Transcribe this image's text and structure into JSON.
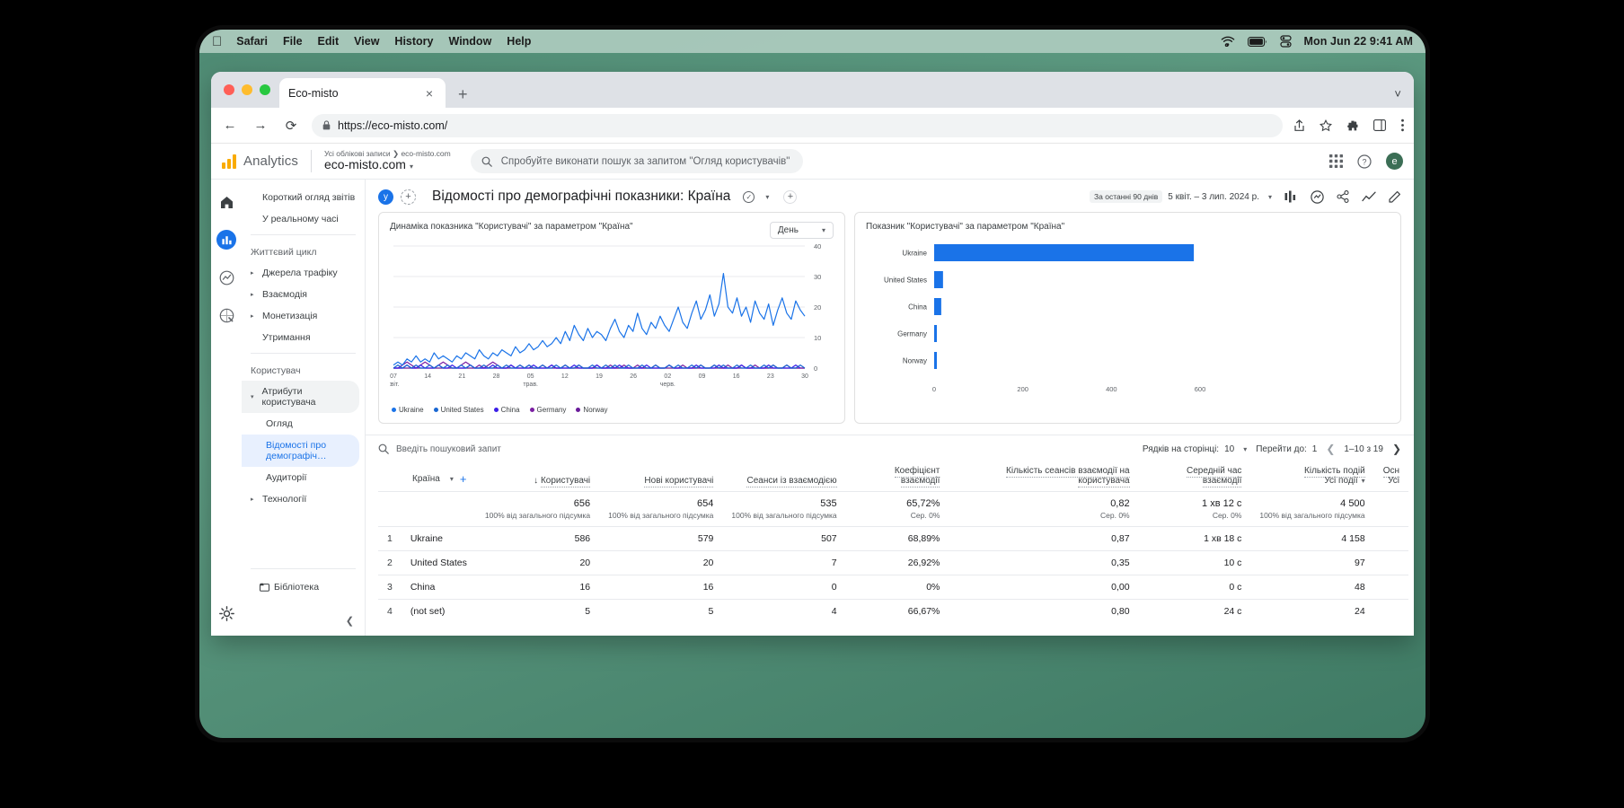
{
  "menubar": {
    "apple": "apple-logo",
    "items": [
      "Safari",
      "File",
      "Edit",
      "View",
      "History",
      "Window",
      "Help"
    ],
    "clock": "Mon Jun 22  9:41 AM",
    "icons": [
      "wifi-icon",
      "battery-icon",
      "control-center-icon"
    ]
  },
  "browser": {
    "tab_title": "Eco-misto",
    "tab_close": "×",
    "new_tab": "+",
    "tabs_chevron": "˅",
    "back": "←",
    "forward": "→",
    "reload": "⟳",
    "lock": "🔒",
    "url": "https://eco-misto.com/",
    "toolbar_icons": [
      "share-icon",
      "bookmark-star-icon",
      "extensions-icon",
      "sidebar-icon",
      "menu-kebab-icon"
    ]
  },
  "ga_header": {
    "product": "Analytics",
    "breadcrumb": "Усі облікові записи  ❯  eco-misto.com",
    "property": "eco-misto.com",
    "property_caret": "▾",
    "search_placeholder": "Спробуйте виконати пошук за запитом \"Огляд користувачів\"",
    "search_icon": "search-icon",
    "apps_icon": "apps-grid-icon",
    "help_icon": "help-circle-icon",
    "avatar_letter": "e"
  },
  "rail": {
    "items": [
      "home-icon",
      "reports-icon",
      "explore-icon",
      "advertising-icon"
    ],
    "active_index": 1,
    "settings": "gear-icon"
  },
  "sidebar": {
    "top_items": [
      {
        "label": "Короткий огляд звітів"
      },
      {
        "label": "У реальному часі"
      }
    ],
    "group_lifecycle": "Життєвий цикл",
    "lifecycle_items": [
      {
        "label": "Джерела трафіку",
        "caret": "▸"
      },
      {
        "label": "Взаємодія",
        "caret": "▸"
      },
      {
        "label": "Монетизація",
        "caret": "▸"
      },
      {
        "label": "Утримання",
        "caret": ""
      }
    ],
    "group_user": "Користувач",
    "user_items": [
      {
        "label": "Атрибути користувача",
        "caret": "▾"
      }
    ],
    "user_subitems": [
      {
        "label": "Огляд",
        "active": false
      },
      {
        "label": "Відомості про демографіч…",
        "active": true
      },
      {
        "label": "Аудиторії",
        "active": false
      }
    ],
    "tech_item": {
      "label": "Технології",
      "caret": "▸"
    },
    "library": {
      "label": "Бібліотека",
      "icon": "library-icon"
    },
    "collapse_icon": "chevron-left-icon"
  },
  "page": {
    "chip_y": "у",
    "chip_plus": "+",
    "title": "Відомості про демографічні показники: Країна",
    "check_icon": "check-circle-icon",
    "caret": "▾",
    "add_comparison": "+",
    "date_badge": "За останні 90 днів",
    "date_range": "5 квіт. – 3 лип. 2024 р.",
    "date_caret": "▾",
    "actions": [
      "insights-icon",
      "share-insights-icon",
      "share-icon",
      "trend-icon",
      "edit-pencil-icon"
    ]
  },
  "cards": {
    "left": {
      "title": "Динаміка показника \"Користувачі\" за параметром \"Країна\"",
      "granularity": "День",
      "granularity_caret": "▾"
    },
    "right": {
      "title": "Показник \"Користувачі\" за параметром \"Країна\""
    }
  },
  "legend": [
    {
      "label": "Ukraine",
      "color": "#1a73e8"
    },
    {
      "label": "United States",
      "color": "#1967d2"
    },
    {
      "label": "China",
      "color": "#3b1ee8"
    },
    {
      "label": "Germany",
      "color": "#7b1fa2"
    },
    {
      "label": "Norway",
      "color": "#6a1b9a"
    }
  ],
  "chart_data": [
    {
      "type": "line",
      "title": "Динаміка показника \"Користувачі\" за параметром \"Країна\"",
      "xlabel": "",
      "ylabel": "",
      "ylim": [
        0,
        40
      ],
      "yticks": [
        0,
        10,
        20,
        30,
        40
      ],
      "xticks": [
        "07\nквіт.",
        "14",
        "21",
        "28",
        "05\nтрав.",
        "12",
        "19",
        "26",
        "02\nчерв.",
        "09",
        "16",
        "23",
        "30"
      ],
      "grid": true,
      "legend_position": "bottom",
      "series": [
        {
          "name": "Ukraine",
          "color": "#1a73e8",
          "values": [
            1,
            2,
            1,
            3,
            2,
            4,
            2,
            3,
            2,
            5,
            3,
            4,
            3,
            2,
            4,
            3,
            5,
            4,
            3,
            6,
            4,
            3,
            5,
            4,
            6,
            5,
            4,
            7,
            5,
            6,
            8,
            6,
            7,
            9,
            7,
            8,
            10,
            8,
            12,
            9,
            14,
            11,
            9,
            13,
            10,
            12,
            11,
            9,
            13,
            16,
            12,
            10,
            14,
            12,
            18,
            13,
            11,
            15,
            13,
            17,
            14,
            12,
            16,
            20,
            15,
            13,
            18,
            22,
            16,
            19,
            24,
            17,
            21,
            31,
            20,
            18,
            23,
            17,
            20,
            15,
            22,
            18,
            16,
            21,
            14,
            19,
            23,
            18,
            16,
            22,
            19,
            17
          ]
        },
        {
          "name": "United States",
          "color": "#1967d2",
          "values": [
            0,
            1,
            0,
            1,
            0,
            1,
            0,
            0,
            1,
            0,
            1,
            0,
            1,
            0,
            0,
            1,
            0,
            1,
            0,
            0,
            1,
            0,
            0,
            1,
            0,
            1,
            0,
            0,
            1,
            0,
            1,
            0,
            0,
            1,
            0,
            0,
            1,
            0,
            1,
            0,
            0,
            1,
            0,
            0,
            1,
            0,
            0,
            1,
            0,
            1,
            0,
            0,
            1,
            0,
            0,
            1,
            0,
            0,
            1,
            0,
            0,
            1,
            0,
            1,
            0,
            0,
            1,
            0,
            1,
            0,
            0,
            1,
            0,
            1,
            0,
            0,
            1,
            0,
            0,
            1,
            0,
            0,
            1,
            0,
            1,
            0,
            0,
            1,
            0,
            0,
            1,
            0
          ]
        },
        {
          "name": "China",
          "color": "#3b1ee8",
          "values": [
            0,
            0,
            0,
            1,
            0,
            0,
            1,
            0,
            0,
            0,
            1,
            0,
            0,
            1,
            0,
            0,
            0,
            1,
            0,
            0,
            0,
            0,
            1,
            0,
            0,
            0,
            1,
            0,
            0,
            0,
            0,
            1,
            0,
            0,
            0,
            1,
            0,
            0,
            0,
            0,
            1,
            0,
            0,
            0,
            0,
            1,
            0,
            0,
            0,
            0,
            1,
            0,
            0,
            0,
            0,
            0,
            1,
            0,
            0,
            0,
            0,
            1,
            0,
            0,
            0,
            0,
            0,
            1,
            0,
            0,
            0,
            0,
            1,
            0,
            0,
            0,
            0,
            1,
            0,
            0,
            0,
            0,
            0,
            1,
            0,
            0,
            0,
            0,
            0,
            1,
            0
          ]
        },
        {
          "name": "Germany",
          "color": "#7b1fa2",
          "values": [
            0,
            0,
            1,
            2,
            1,
            0,
            1,
            2,
            1,
            0,
            1,
            2,
            1,
            0,
            0,
            1,
            2,
            1,
            0,
            1,
            0,
            1,
            2,
            1,
            0,
            0,
            1,
            0,
            1,
            0,
            1,
            0,
            0,
            1,
            0,
            1,
            0,
            0,
            1,
            0,
            0,
            1,
            0,
            0,
            0,
            1,
            0,
            0,
            1,
            0,
            0,
            1,
            0,
            0,
            1,
            0,
            0,
            0,
            1,
            0,
            0,
            1,
            0,
            0,
            1,
            0,
            0,
            0,
            1,
            0,
            0,
            1,
            0,
            0,
            1,
            0,
            0,
            1,
            0,
            0,
            1,
            0,
            0,
            0,
            1,
            0,
            0,
            1,
            0,
            0,
            0,
            0
          ]
        },
        {
          "name": "Norway",
          "color": "#6a1b9a",
          "values": [
            0,
            0,
            0,
            0,
            0,
            0,
            0,
            0,
            0,
            0,
            0,
            0,
            0,
            0,
            0,
            0,
            0,
            0,
            0,
            0,
            0,
            0,
            0,
            0,
            0,
            0,
            0,
            0,
            0,
            0,
            0,
            0,
            0,
            0,
            0,
            0,
            0,
            0,
            0,
            0,
            0,
            0,
            0,
            0,
            0,
            0,
            0,
            0,
            0,
            0,
            0,
            0,
            0,
            0,
            0,
            0,
            0,
            0,
            0,
            0,
            0,
            0,
            0,
            0,
            0,
            0,
            0,
            0,
            0,
            0,
            0,
            0,
            0,
            0,
            0,
            0,
            0,
            0,
            0,
            0,
            0,
            0,
            0,
            0,
            0,
            0,
            0,
            0,
            0,
            0,
            0,
            0
          ]
        }
      ]
    },
    {
      "type": "bar",
      "orientation": "horizontal",
      "title": "Показник \"Користувачі\" за параметром \"Країна\"",
      "categories": [
        "Ukraine",
        "United States",
        "China",
        "Germany",
        "Norway"
      ],
      "values": [
        586,
        20,
        16,
        5,
        4
      ],
      "bar_color": "#1a73e8",
      "xlim": [
        0,
        600
      ],
      "xticks": [
        0,
        200,
        400,
        600
      ],
      "grid": false
    }
  ],
  "table": {
    "search_placeholder": "Введіть пошуковий запит",
    "search_icon": "search-icon",
    "rows_per_page_label": "Рядків на сторінці:",
    "rows_per_page_value": "10",
    "rows_per_page_caret": "▾",
    "goto_label": "Перейти до:",
    "goto_value": "1",
    "range_label": "1–10 з 19",
    "prev_icon": "chevron-left-icon",
    "next_icon": "chevron-right-icon",
    "dimension": {
      "label": "Країна",
      "caret": "▾",
      "add": "+"
    },
    "columns": [
      {
        "label": "Користувачі",
        "sort": "↓"
      },
      {
        "label": "Нові користувачі",
        "sort": ""
      },
      {
        "label": "Сеанси із взаємодією",
        "sort": ""
      },
      {
        "label": "Коефіцієнт взаємодії",
        "sort": ""
      },
      {
        "label": "Кількість сеансів взаємодії на користувача",
        "sort": ""
      },
      {
        "label": "Середній час взаємодії",
        "sort": ""
      },
      {
        "label": "Кількість подій",
        "sub": "Усі події",
        "sub_caret": "▾"
      },
      {
        "label": "Осн",
        "sub": "Усі"
      }
    ],
    "summary": [
      {
        "value": "656",
        "note": "100% від загального підсумка"
      },
      {
        "value": "654",
        "note": "100% від загального підсумка"
      },
      {
        "value": "535",
        "note": "100% від загального підсумка"
      },
      {
        "value": "65,72%",
        "note": "Сер. 0%"
      },
      {
        "value": "0,82",
        "note": "Сер. 0%"
      },
      {
        "value": "1 хв 12 с",
        "note": "Сер. 0%"
      },
      {
        "value": "4 500",
        "note": "100% від загального підсумка"
      },
      {
        "value": "",
        "note": ""
      }
    ],
    "rows": [
      {
        "index": "1",
        "dimension": "Ukraine",
        "cells": [
          "586",
          "579",
          "507",
          "68,89%",
          "0,87",
          "1 хв 18 с",
          "4 158",
          ""
        ]
      },
      {
        "index": "2",
        "dimension": "United States",
        "cells": [
          "20",
          "20",
          "7",
          "26,92%",
          "0,35",
          "10 с",
          "97",
          ""
        ]
      },
      {
        "index": "3",
        "dimension": "China",
        "cells": [
          "16",
          "16",
          "0",
          "0%",
          "0,00",
          "0 с",
          "48",
          ""
        ]
      },
      {
        "index": "4",
        "dimension": "(not set)",
        "cells": [
          "5",
          "5",
          "4",
          "66,67%",
          "0,80",
          "24 с",
          "24",
          ""
        ]
      }
    ]
  }
}
